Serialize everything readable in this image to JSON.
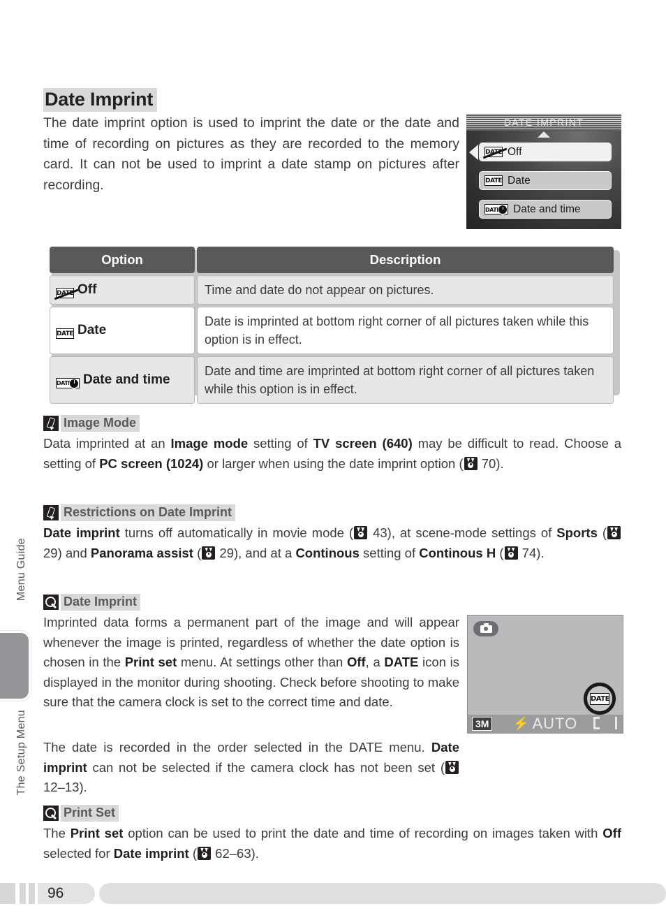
{
  "sidebar": {
    "labels": [
      "Menu Guide",
      "The Setup Menu"
    ]
  },
  "page": {
    "title": "Date Imprint",
    "intro": "The date imprint option is used to imprint the date or the date and time of recording on pictures as they are recorded to the memory card.  It can not be used to imprint a date stamp on pictures after recording.",
    "number": "96"
  },
  "camera_menu": {
    "title": "DATE IMPRINT",
    "items": [
      {
        "icon": "date-off-icon",
        "label": "Off",
        "selected": true
      },
      {
        "icon": "date-icon",
        "label": "Date",
        "selected": false
      },
      {
        "icon": "date-and-time-icon",
        "label": "Date and time",
        "selected": false
      }
    ]
  },
  "table": {
    "headers": [
      "Option",
      "Description"
    ],
    "rows": [
      {
        "icon": "date-off-icon",
        "option": "Off",
        "description": "Time and date do not appear on pictures."
      },
      {
        "icon": "date-icon",
        "option": "Date",
        "description": "Date is imprinted at bottom right corner of all pictures taken while this option is in effect."
      },
      {
        "icon": "date-and-time-icon",
        "option": "Date and time",
        "description": "Date and time are imprinted at bottom right corner of all pictures taken while this option is in effect."
      }
    ]
  },
  "notes": [
    {
      "icon": "pencil-icon",
      "heading": "Image Mode",
      "body_html": "Data imprinted at an <b>Image mode</b> setting of <b>TV screen (640)</b> may be difficult to read. Choose a setting of <b>PC screen (1024)</b> or larger when using the date imprint option (<span class=\"ref\" data-name=\"reference-icon\" data-interactable=\"false\"><i></i></span> 70)."
    },
    {
      "icon": "pencil-icon",
      "heading": "Restrictions on Date Imprint",
      "body_html": "<b>Date imprint</b> turns off automatically in movie mode (<span class=\"ref\" data-name=\"reference-icon\" data-interactable=\"false\"><i></i></span> 43), at scene-mode settings of <b>Sports</b> (<span class=\"ref\" data-name=\"reference-icon\" data-interactable=\"false\"><i></i></span> 29) and <b>Panorama assist</b> (<span class=\"ref\" data-name=\"reference-icon\" data-interactable=\"false\"><i></i></span> 29), and at a <b>Continous</b> setting of <b>Continous H</b> (<span class=\"ref\" data-name=\"reference-icon\" data-interactable=\"false\"><i></i></span> 74)."
    },
    {
      "icon": "lens-icon",
      "heading": "Date Imprint",
      "body_html": "Imprinted data forms a permanent part of the image and will appear whenever the image is printed, regardless of whether the date option is chosen in the <b>Print set</b> menu.  At settings other than <b>Off</b>, a <b>DATE</b> icon is displayed in the monitor during shooting.  Check before shooting to make sure that the camera clock is set to the correct time and date."
    },
    {
      "icon": "lens-icon",
      "heading": "Print Set",
      "body_html": "The <b>Print set</b> option can be used to print the date and time of recording on images taken with <b>Off</b> selected for <b>Date imprint</b> (<span class=\"ref\" data-name=\"reference-icon\" data-interactable=\"false\"><i></i></span> 62&#8211;63)."
    }
  ],
  "note_extra_paragraph_html": "The date is recorded in the order selected in the DATE menu. <b>Date imprint</b> can not be selected if the camera clock has not been set (<span class=\"ref\" data-name=\"reference-icon\" data-interactable=\"false\"><i></i></span> 12&#8211;13).",
  "shooting_display": {
    "mode_icon": "camera-mode-icon",
    "image_size": "3M",
    "flash_mode": "AUTO",
    "flash_icon": "flash-bolt-icon",
    "date_icon": "date-imprint-indicator-icon",
    "battery_icon": "battery-icon"
  },
  "glyphs": {
    "date_text": "DATE"
  }
}
